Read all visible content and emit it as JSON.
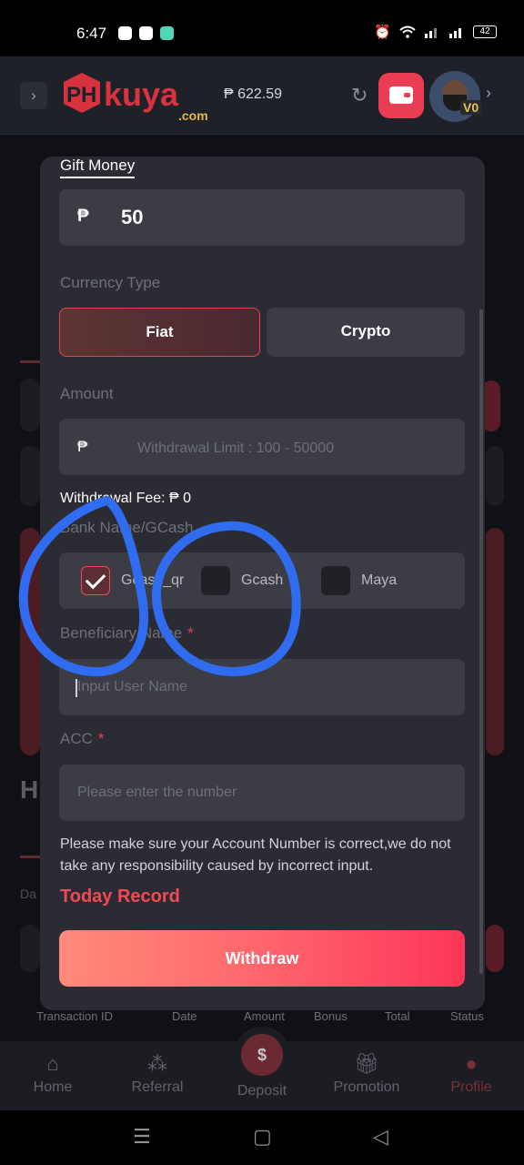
{
  "status_bar": {
    "time": "6:47",
    "battery": "42"
  },
  "header": {
    "logo_text_ph": "PH",
    "logo_text_kuya": "kuya",
    "logo_text_com": ".com",
    "balance": "₱ 622.59",
    "vip_level": "V0"
  },
  "modal": {
    "title": "Gift Money",
    "gift_currency": "₱",
    "gift_value": "50",
    "currency_type_label": "Currency Type",
    "currency_options": [
      "Fiat",
      "Crypto"
    ],
    "amount_label": "Amount",
    "amount_currency": "₱",
    "amount_placeholder": "Withdrawal Limit : 100 - 50000",
    "withdrawal_fee": "Withdrawal Fee: ₱ 0",
    "bank_label": "Bank Name/GCash",
    "bank_options": [
      {
        "label": "Gcash_qr",
        "checked": true
      },
      {
        "label": "Gcash",
        "checked": false
      },
      {
        "label": "Maya",
        "checked": false
      }
    ],
    "beneficiary_label": "Beneficiary Name",
    "beneficiary_placeholder": "Input User Name",
    "acc_label": "ACC",
    "acc_placeholder": "Please enter the number",
    "note": "Please make sure your Account Number is correct,we do not take any responsibility caused by incorrect input.",
    "today_record": "Today Record",
    "withdraw_button": "Withdraw"
  },
  "background": {
    "heading_initial": "H",
    "table_headers": [
      "Transaction ID",
      "Date",
      "Amount",
      "Bonus",
      "Total",
      "Status"
    ],
    "small_label": "Da"
  },
  "bottom_nav": {
    "items": [
      {
        "label": "Home",
        "icon": "home-icon"
      },
      {
        "label": "Referral",
        "icon": "referral-icon"
      },
      {
        "label": "Deposit",
        "icon": "deposit-icon"
      },
      {
        "label": "Promotion",
        "icon": "gift-icon"
      },
      {
        "label": "Profile",
        "icon": "profile-icon",
        "active": true
      }
    ]
  },
  "colors": {
    "accent": "#ef3b52",
    "modal_bg": "#2b2c33",
    "field_bg": "#3b3c44",
    "annotation_blue": "#2f6cf0"
  }
}
